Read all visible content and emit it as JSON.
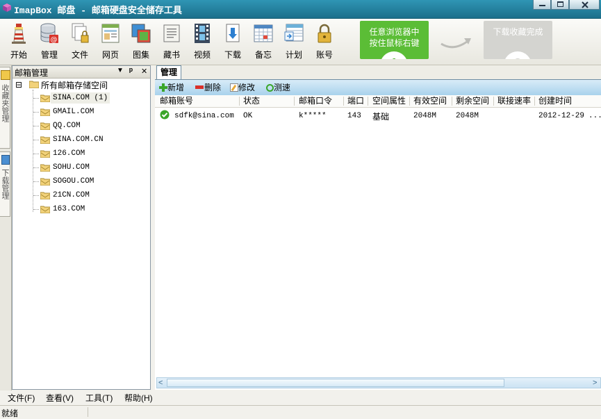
{
  "window": {
    "title": "ImapBox 邮盘 - 邮箱硬盘安全储存工具"
  },
  "toolbar": {
    "buttons": [
      {
        "label": "开始",
        "icon": "lighthouse-icon"
      },
      {
        "label": "管理",
        "icon": "database-mail-icon"
      },
      {
        "label": "文件",
        "icon": "files-icon"
      },
      {
        "label": "网页",
        "icon": "webpage-icon"
      },
      {
        "label": "图集",
        "icon": "picture-icon"
      },
      {
        "label": "藏书",
        "icon": "book-icon"
      },
      {
        "label": "视频",
        "icon": "film-icon"
      },
      {
        "label": "下载",
        "icon": "download-icon"
      },
      {
        "label": "备忘",
        "icon": "calendar-icon"
      },
      {
        "label": "计划",
        "icon": "schedule-icon"
      },
      {
        "label": "账号",
        "icon": "lock-icon"
      }
    ]
  },
  "steps": {
    "step1_text_line1": "任意浏览器中",
    "step1_text_line2": "按住鼠标右键",
    "step1_num": "1",
    "step2_text": "下载收藏完成",
    "step2_num": "2"
  },
  "side_tabs": {
    "tab1": "收藏夹管理",
    "tab2": "下载管理"
  },
  "left_panel": {
    "title": "邮箱管理",
    "dropdown_glyph": "▼",
    "pin_glyph": "ᵖ",
    "close_glyph": "✕",
    "tree_root": "所有邮箱存储空间",
    "tree_toggle": "⊟",
    "tree_items": [
      "SINA.COM (1)",
      "GMAIL.COM",
      "QQ.COM",
      "SINA.COM.CN",
      "126.COM",
      "SOHU.COM",
      "SOGOU.COM",
      "21CN.COM",
      "163.COM"
    ]
  },
  "right_panel": {
    "tab": "管理",
    "actions": {
      "add": "新增",
      "delete": "删除",
      "edit": "修改",
      "speedtest": "测速"
    },
    "columns": [
      "邮箱账号",
      "状态",
      "邮箱口令",
      "端口",
      "空间属性",
      "有效空间",
      "剩余空间",
      "联接速率",
      "创建时间"
    ],
    "rows": [
      {
        "account": "sdfk@sina.com",
        "status": "OK",
        "password": "k*****",
        "port": "143",
        "space_type": "基础",
        "effective": "2048M",
        "remaining": "2048M",
        "speed": "",
        "created": "2012-12-29",
        "overflow": "..."
      }
    ],
    "scroll_left": "<",
    "scroll_right": ">"
  },
  "menubar": {
    "file": "文件(F)",
    "view": "查看(V)",
    "tools": "工具(T)",
    "help": "帮助(H)"
  },
  "status": {
    "text": "就绪"
  },
  "colors": {
    "titlebar": "#1f7a96",
    "step_active": "#5bbd36",
    "step_inactive": "#d4d4d0",
    "actionbar": "#b9dcf0"
  }
}
